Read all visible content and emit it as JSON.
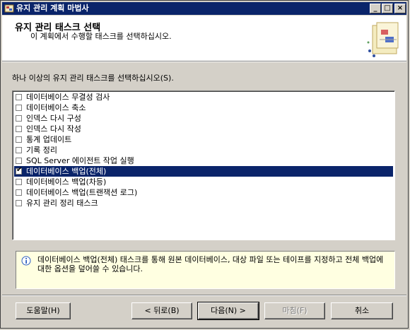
{
  "window": {
    "title": "유지 관리 계획 마법사"
  },
  "titlebar_buttons": {
    "minimize": "_",
    "maximize": "□",
    "close": "×"
  },
  "header": {
    "title": "유지 관리 태스크 선택",
    "subtitle": "이 계획에서 수행할 태스크를 선택하십시오."
  },
  "instruction": "하나 이상의 유지 관리 태스크를 선택하십시오(S).",
  "tasks": [
    {
      "label": "데이터베이스 무결성 검사",
      "checked": false,
      "selected": false
    },
    {
      "label": "데이터베이스 축소",
      "checked": false,
      "selected": false
    },
    {
      "label": "인덱스 다시 구성",
      "checked": false,
      "selected": false
    },
    {
      "label": "인덱스 다시 작성",
      "checked": false,
      "selected": false
    },
    {
      "label": "통계 업데이트",
      "checked": false,
      "selected": false
    },
    {
      "label": "기록 정리",
      "checked": false,
      "selected": false
    },
    {
      "label": "SQL Server 에이전트 작업 실행",
      "checked": false,
      "selected": false
    },
    {
      "label": "데이터베이스 백업(전체)",
      "checked": true,
      "selected": true
    },
    {
      "label": "데이터베이스 백업(차등)",
      "checked": false,
      "selected": false
    },
    {
      "label": "데이터베이스 백업(트랜잭션 로그)",
      "checked": false,
      "selected": false
    },
    {
      "label": "유지 관리 정리 태스크",
      "checked": false,
      "selected": false
    }
  ],
  "description": "데이터베이스 백업(전체) 태스크를 통해 원본 데이터베이스, 대상 파일 또는 테이프를 지정하고 전체 백업에 대한 옵션을 덮어쓸 수 있습니다.",
  "buttons": {
    "help": "도움말(H)",
    "back": "< 뒤로(B)",
    "next": "다음(N) >",
    "finish": "마침(F)",
    "cancel": "취소"
  },
  "colors": {
    "titlebar": "#0a246a",
    "selection": "#0a246a",
    "info_bg": "#ffffe1",
    "dialog_bg": "#d4d0c8"
  }
}
